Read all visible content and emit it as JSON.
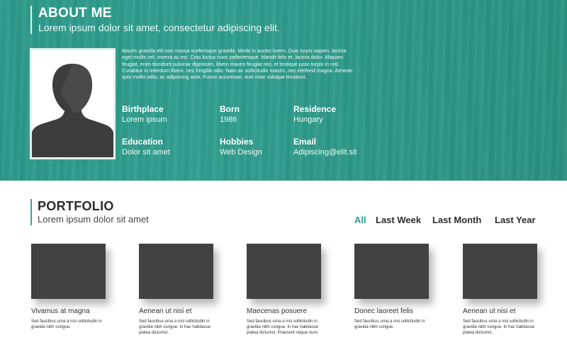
{
  "about": {
    "title": "ABOUT ME",
    "subtitle": "Lorem ipsum dolor sit amet, consectetur adipiscing elit.",
    "bio": "Mauris gravida elit non massa scelerisque gravida. Morbi in auctor lorem. Duis turpis sapien, lacinia eget mollis vel, viverra ac est. Cras luctus nunc pellentesque. blandit felis et, lacinia dolor. Aliquam feugiat, enim tincidunt pulvinar dignissim, libero mauris feugiat nisl, et tristique justo turpis in nisl. Curabitur in interdum libero, nec fringilla odio. Nam ac sollicitudin mauris, nec eleifend magna. Aenean quis mollis odio, ac adipiscing ante. Fusce accumsan, erat vitae volutpat tincidunt.",
    "facts": [
      {
        "label": "Birthplace",
        "value": "Lorem ipsum"
      },
      {
        "label": "Born",
        "value": "1986"
      },
      {
        "label": "Residence",
        "value": "Hungary"
      },
      {
        "label": "Education",
        "value": "Dolor sit amet"
      },
      {
        "label": "Hobbies",
        "value": "Web Design"
      },
      {
        "label": "Email",
        "value": "Adipiscing@elit.sit"
      }
    ],
    "accent_color": "#2b9a8a"
  },
  "portfolio": {
    "title": "PORTFOLIO",
    "subtitle": "Lorem ipsum dolor sit amet",
    "filters": [
      "All",
      "Last Week",
      "Last Month",
      "Last Year"
    ],
    "active_filter": "All",
    "items": [
      {
        "title": "Vivamus at magna",
        "text": "Sed faucibus urna a nisi sollicitudin in gravida nibh congue."
      },
      {
        "title": "Aenean ut nisi et",
        "text": "Sed faucibus urna a nisi sollicitudin in gravida nibh congue. In hac habitasse platea dictumst."
      },
      {
        "title": "Maecenas posuere",
        "text": "Sed faucibus urna a nisi sollicitudin in gravida nibh congue. In hac habitasse platea dictumst. Praesent neque nunc"
      },
      {
        "title": "Donec laoreet felis",
        "text": "Sed faucibus urna a nisi sollicitudin in gravida nibh congue."
      },
      {
        "title": "Aenean ut nisi et",
        "text": "Sed faucibus urna a nisi sollicitudin in gravida nibh congue. In hac habitasse platea dictumst."
      }
    ],
    "thumb_color": "#424242",
    "active_color": "#2f9e8f"
  },
  "icons": {
    "profile_photo": "person-silhouette-icon"
  }
}
